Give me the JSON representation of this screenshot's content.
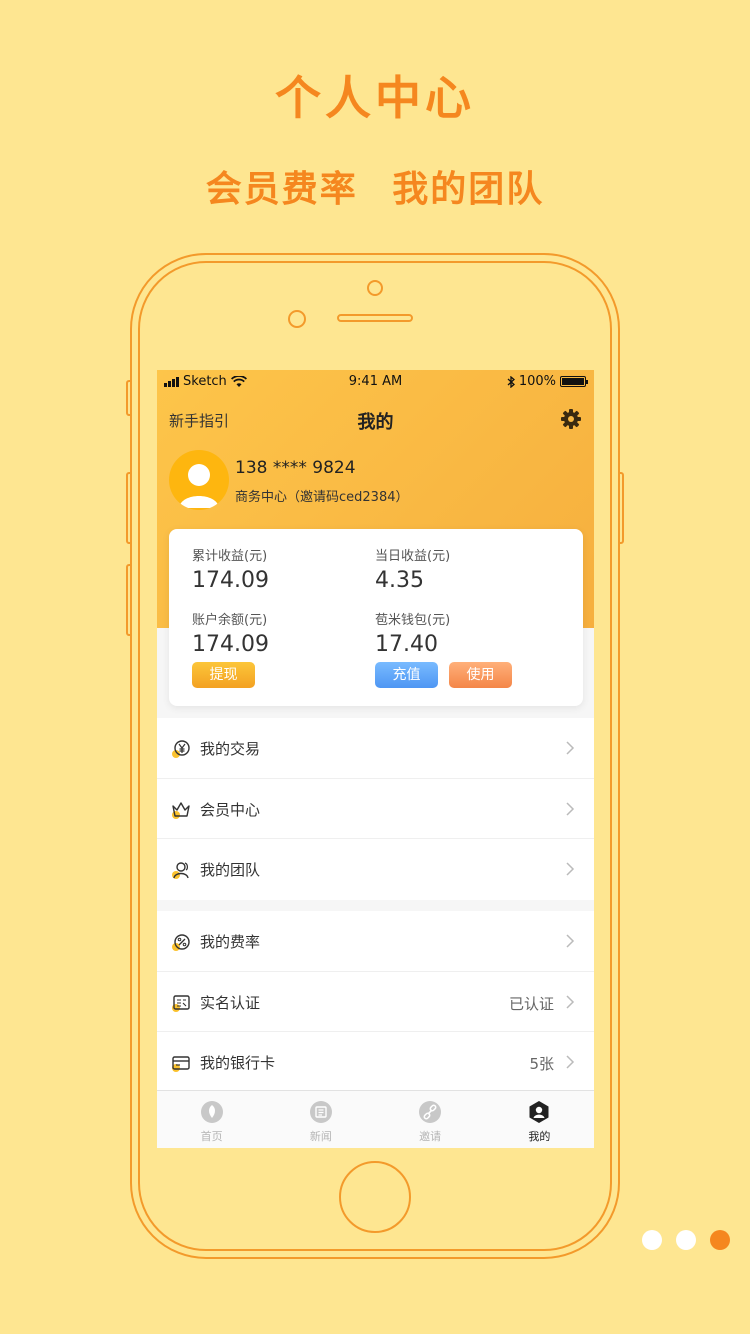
{
  "hero": {
    "title": "个人中心",
    "sub_left": "会员费率",
    "sub_right": "我的团队"
  },
  "status_bar": {
    "carrier": "Sketch",
    "time": "9:41 AM",
    "battery": "100%"
  },
  "nav": {
    "guide": "新手指引",
    "title": "我的"
  },
  "profile": {
    "phone": "138 **** 9824",
    "invite": "商务中心（邀请码ced2384）"
  },
  "stats": {
    "total_income_label": "累计收益(元)",
    "total_income": "174.09",
    "today_income_label": "当日收益(元)",
    "today_income": "4.35",
    "balance_label": "账户余额(元)",
    "balance": "174.09",
    "wallet_label": "苞米钱包(元)",
    "wallet": "17.40"
  },
  "buttons": {
    "withdraw": "提现",
    "recharge": "充值",
    "use": "使用"
  },
  "menu_group1": [
    {
      "label": "我的交易",
      "icon": "yen-icon"
    },
    {
      "label": "会员中心",
      "icon": "crown-icon"
    },
    {
      "label": "我的团队",
      "icon": "team-icon"
    }
  ],
  "menu_group2": [
    {
      "label": "我的费率",
      "icon": "percent-icon",
      "extra": ""
    },
    {
      "label": "实名认证",
      "icon": "id-card-icon",
      "extra": "已认证"
    },
    {
      "label": "我的银行卡",
      "icon": "bank-card-icon",
      "extra": "5张"
    }
  ],
  "tabbar": [
    {
      "label": "首页",
      "icon": "home-icon",
      "active": false
    },
    {
      "label": "新闻",
      "icon": "news-icon",
      "active": false
    },
    {
      "label": "邀请",
      "icon": "link-icon",
      "active": false
    },
    {
      "label": "我的",
      "icon": "user-icon",
      "active": true
    }
  ],
  "colors": {
    "accent": "#F5871F",
    "background": "#FEE691",
    "header": "#FDC54A"
  }
}
